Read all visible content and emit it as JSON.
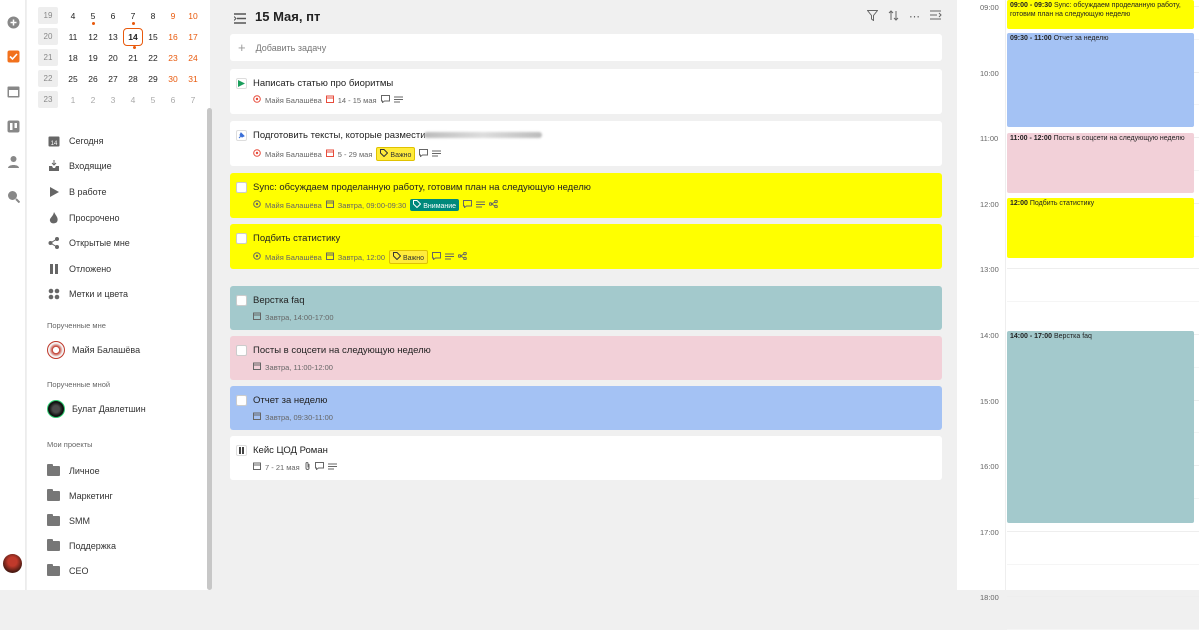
{
  "calendar": {
    "rows": [
      {
        "week": "19",
        "days": [
          {
            "d": "4"
          },
          {
            "d": "5",
            "dot": true
          },
          {
            "d": "6"
          },
          {
            "d": "7",
            "dot": true
          },
          {
            "d": "8"
          },
          {
            "d": "9",
            "wkend": true
          },
          {
            "d": "10",
            "wkend": true
          }
        ]
      },
      {
        "week": "20",
        "days": [
          {
            "d": "11"
          },
          {
            "d": "12"
          },
          {
            "d": "13"
          },
          {
            "d": "14",
            "sel": true,
            "dot": true
          },
          {
            "d": "15"
          },
          {
            "d": "16",
            "wkend": true
          },
          {
            "d": "17",
            "wkend": true
          }
        ]
      },
      {
        "week": "21",
        "days": [
          {
            "d": "18"
          },
          {
            "d": "19"
          },
          {
            "d": "20"
          },
          {
            "d": "21"
          },
          {
            "d": "22"
          },
          {
            "d": "23",
            "wkend": true
          },
          {
            "d": "24",
            "wkend": true
          }
        ]
      },
      {
        "week": "22",
        "days": [
          {
            "d": "25"
          },
          {
            "d": "26"
          },
          {
            "d": "27"
          },
          {
            "d": "28"
          },
          {
            "d": "29"
          },
          {
            "d": "30",
            "wkend": true
          },
          {
            "d": "31",
            "wkend": true
          }
        ]
      },
      {
        "week": "23",
        "days": [
          {
            "d": "1",
            "other": true
          },
          {
            "d": "2",
            "other": true
          },
          {
            "d": "3",
            "other": true
          },
          {
            "d": "4",
            "other": true
          },
          {
            "d": "5",
            "other": true
          },
          {
            "d": "6",
            "other": true
          },
          {
            "d": "7",
            "other": true
          }
        ]
      }
    ]
  },
  "nav": [
    {
      "label": "Сегодня",
      "icon": "calendar-today-icon"
    },
    {
      "label": "Входящие",
      "icon": "inbox-icon"
    },
    {
      "label": "В работе",
      "icon": "play-icon"
    },
    {
      "label": "Просрочено",
      "icon": "flame-icon"
    },
    {
      "label": "Открытые мне",
      "icon": "share-icon"
    },
    {
      "label": "Отложено",
      "icon": "pause-icon"
    },
    {
      "label": "Метки и цвета",
      "icon": "tags-grid-icon"
    }
  ],
  "assigned_to_me": {
    "title": "Порученные мне",
    "person": "Майя Балашёва"
  },
  "assigned_by_me": {
    "title": "Порученные мной",
    "person": "Булат Давлетшин"
  },
  "projects": {
    "title": "Мои проекты",
    "items": [
      "Личное",
      "Маркетинг",
      "SMM",
      "Поддержка",
      "CEO"
    ]
  },
  "header": {
    "title": "15 Мая, пт"
  },
  "add_task": {
    "placeholder": "Добавить задачу"
  },
  "tasks": [
    {
      "title": "Написать статью про биоритмы",
      "author": "Майя Балашёва",
      "date": "14 - 15 мая",
      "bg": "#ffffff",
      "status": "play"
    },
    {
      "title": "Подготовить тексты, которые размести",
      "author": "Майя Балашёва",
      "date": "5 - 29 мая",
      "tag": "Важно",
      "bg": "#ffffff",
      "status": "pin"
    },
    {
      "title": "Sync: обсуждаем проделанную работу, готовим план на следующую неделю",
      "author": "Майя Балашёва",
      "date": "Завтра, 09:00-09:30",
      "tag": "Внимание",
      "bg": "#ffff00",
      "status": "check"
    },
    {
      "title": "Подбить статистику",
      "author": "Майя Балашёва",
      "date": "Завтра, 12:00",
      "tag": "Важно",
      "bg": "#ffff00",
      "status": "check"
    },
    {
      "title": "Верстка faq",
      "date": "Завтра, 14:00-17:00",
      "bg": "#a3c9cc",
      "status": "check"
    },
    {
      "title": "Посты в соцсети на следующую неделю",
      "date": "Завтра, 11:00-12:00",
      "bg": "#f2d0d8",
      "status": "check"
    },
    {
      "title": "Отчет за неделю",
      "date": "Завтра, 09:30-11:00",
      "bg": "#a4c2f4",
      "status": "check"
    },
    {
      "title": "Кейс ЦОД Роман",
      "date": "7 - 21 мая",
      "bg": "#ffffff",
      "status": "pause"
    }
  ],
  "timeline": {
    "hours": [
      "09:00",
      "10:00",
      "11:00",
      "12:00",
      "13:00",
      "14:00",
      "15:00",
      "16:00",
      "17:00",
      "18:00"
    ],
    "events": [
      {
        "time": "09:00 - 09:30",
        "title": "Sync: обсуждаем проделанную работу, готовим план на следующую неделю",
        "color": "#ffff00"
      },
      {
        "time": "09:30 - 11:00",
        "title": "Отчет за неделю",
        "color": "#a4c2f4"
      },
      {
        "time": "11:00 - 12:00",
        "title": "Посты в соцсети на следующую неделю",
        "color": "#f2d0d8"
      },
      {
        "time": "12:00",
        "title": "Подбить статистику",
        "color": "#ffff00"
      },
      {
        "time": "14:00 - 17:00",
        "title": "Верстка faq",
        "color": "#a3c9cc"
      }
    ]
  }
}
